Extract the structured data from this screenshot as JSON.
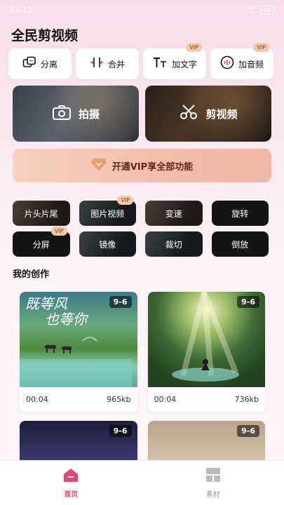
{
  "status": {
    "time": "14:42",
    "battery": "64"
  },
  "app": {
    "title": "全民剪视频"
  },
  "tools": [
    {
      "label": "分离",
      "icon": "split-icon",
      "vip": false
    },
    {
      "label": "合并",
      "icon": "merge-icon",
      "vip": false
    },
    {
      "label": "加文字",
      "icon": "text-icon",
      "vip": true
    },
    {
      "label": "加音频",
      "icon": "audio-icon",
      "vip": true
    }
  ],
  "vip_label": "VIP",
  "big_actions": [
    {
      "label": "拍摄",
      "icon": "camera-icon"
    },
    {
      "label": "剪视频",
      "icon": "scissors-icon"
    }
  ],
  "vip_banner": {
    "label": "开通VIP享全部功能"
  },
  "functions": [
    {
      "label": "片头片尾",
      "vip": false
    },
    {
      "label": "图片视频",
      "vip": true
    },
    {
      "label": "变速",
      "vip": false
    },
    {
      "label": "旋转",
      "vip": false
    },
    {
      "label": "分屏",
      "vip": true
    },
    {
      "label": "镜像",
      "vip": false
    },
    {
      "label": "裁切",
      "vip": false
    },
    {
      "label": "倒放",
      "vip": false
    }
  ],
  "my_works": {
    "title": "我的创作",
    "items": [
      {
        "ratio": "9-6",
        "duration": "00:04",
        "size": "965kb"
      },
      {
        "ratio": "9-6",
        "duration": "00:04",
        "size": "736kb"
      },
      {
        "ratio": "9-6",
        "duration": "",
        "size": ""
      },
      {
        "ratio": "9-6",
        "duration": "",
        "size": ""
      }
    ]
  },
  "thumb_text": {
    "line1": "既等风",
    "line2": "也等你"
  },
  "tabs": [
    {
      "label": "首页",
      "icon": "home-icon",
      "active": true
    },
    {
      "label": "素材",
      "icon": "material-icon",
      "active": false
    }
  ],
  "colors": {
    "accent": "#e8466f",
    "vip_tag": "#f7c7a6",
    "banner": "#f3bfae"
  }
}
